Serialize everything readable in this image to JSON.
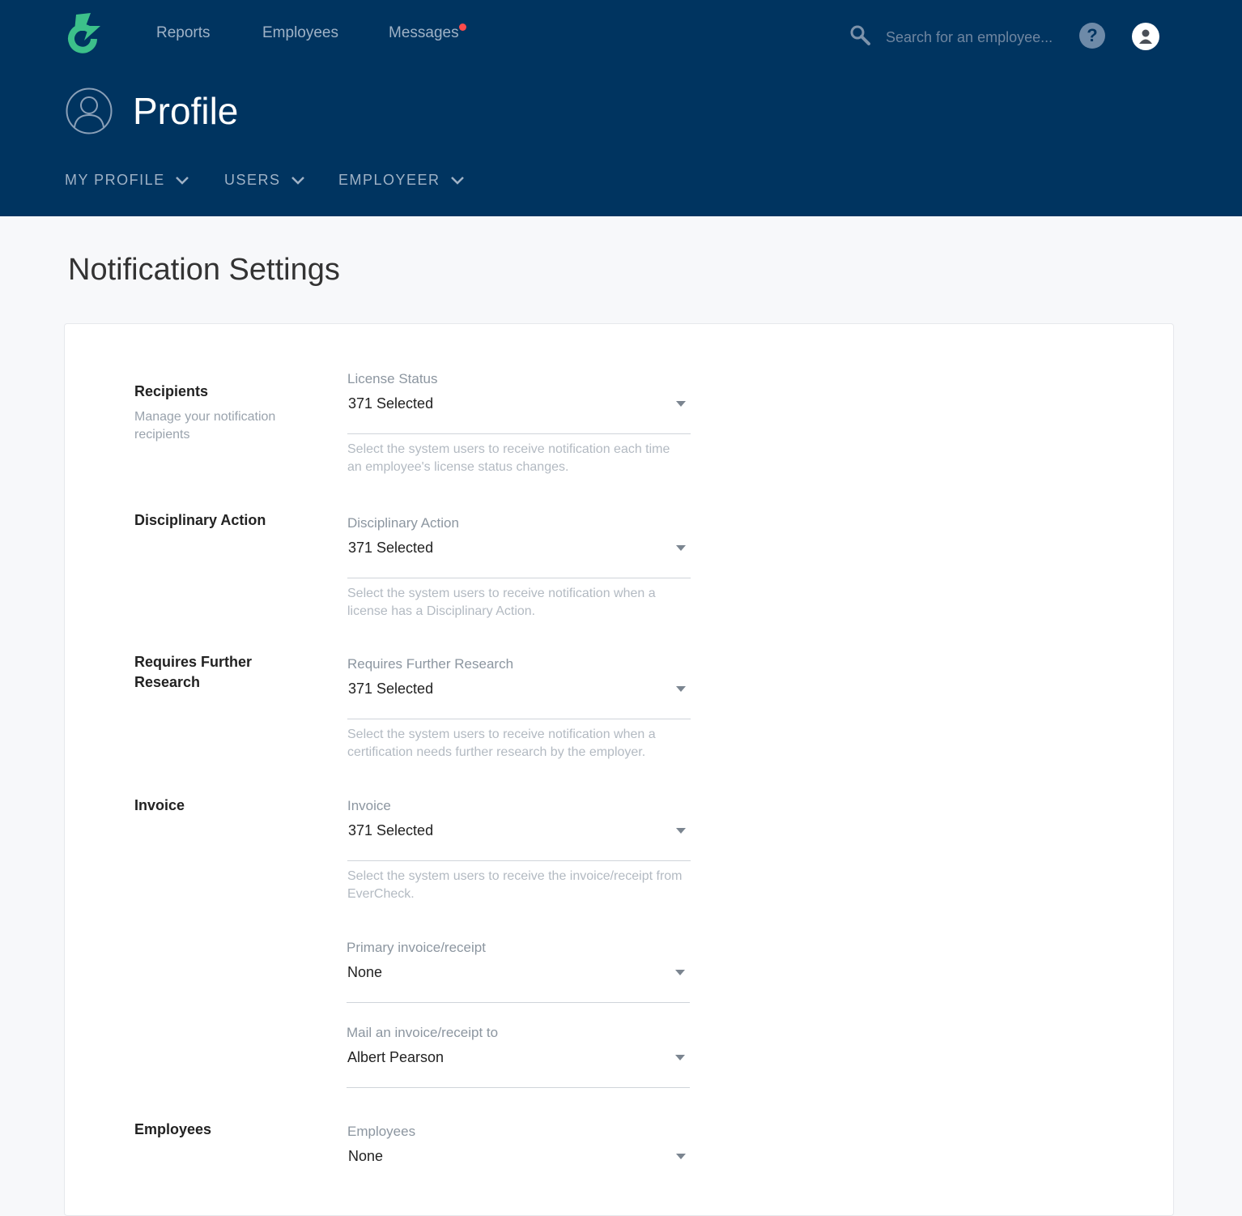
{
  "nav": {
    "links": [
      "Reports",
      "Employees",
      "Messages"
    ],
    "search_placeholder": "Search for an employee...",
    "help_glyph": "?"
  },
  "header": {
    "title": "Profile",
    "subnav": [
      "MY PROFILE",
      "USERS",
      "EMPLOYEER"
    ]
  },
  "main": {
    "title": "Notification Settings",
    "groups": [
      {
        "title": "Recipients",
        "desc": "Manage your notification recipients",
        "fields": [
          {
            "label": "License Status",
            "value": "371 Selected",
            "help": "Select the system users to receive notification each time an employee's license status changes."
          }
        ]
      },
      {
        "title": "Disciplinary Action",
        "fields": [
          {
            "label": "Disciplinary Action",
            "value": "371 Selected",
            "help": "Select the system users to receive notification when a license has a Disciplinary Action."
          }
        ]
      },
      {
        "title": "Requires Further Research",
        "fields": [
          {
            "label": "Requires Further Research",
            "value": "371 Selected",
            "help": "Select the system users to receive notification when a certification needs further research by the employer."
          }
        ]
      },
      {
        "title": "Invoice",
        "fields": [
          {
            "label": "Invoice",
            "value": "371 Selected",
            "help": "Select the system users to receive the invoice/receipt from EverCheck."
          },
          {
            "label": "Primary invoice/receipt",
            "value": "None"
          },
          {
            "label": "Mail an invoice/receipt to",
            "value": "Albert Pearson"
          }
        ]
      },
      {
        "title": "Employees",
        "fields": [
          {
            "label": "Employees",
            "value": "None"
          }
        ]
      }
    ]
  },
  "colors": {
    "header_bg": "#003460",
    "logo_green": "#3cc08a",
    "notification_dot": "#ff4b4b"
  },
  "icons": [
    "logo-icon",
    "search-icon",
    "help-icon",
    "user-avatar-icon",
    "profile-icon",
    "chevron-down-icon",
    "caret-down-icon"
  ]
}
